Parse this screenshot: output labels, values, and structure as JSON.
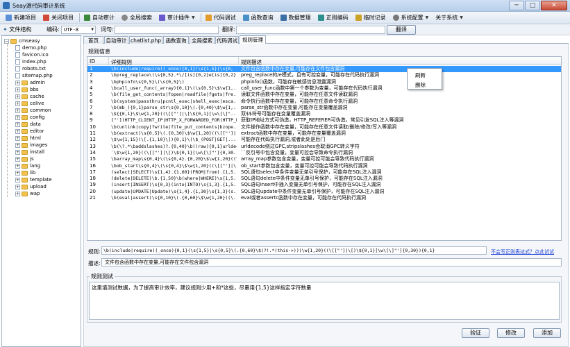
{
  "window": {
    "title": "Seay源代码审计系统"
  },
  "window_controls": {
    "minimize": "─",
    "maximize": "□",
    "close": "✕"
  },
  "menu": {
    "new_project": "新建项目",
    "close_project": "关闭项目",
    "auto_audit": "自动审计",
    "global_search": "全局搜索",
    "audit_plugins": "审计插件",
    "code_debug": "代码调试",
    "function_lookup": "函数查询",
    "data_management": "数据管理",
    "regex_encoding": "正则编码",
    "temp_notes": "临时记录",
    "system_config": "系统配置",
    "about_system": "关于系统"
  },
  "toolbar": {
    "file_structure": "文件结构",
    "encoding_label": "编码:",
    "encoding_value": "UTF-8",
    "word_label": "词句:",
    "translate_label": "翻译:",
    "translate_button": "翻译"
  },
  "tree": {
    "root": "cmseasy",
    "files": [
      "demo.php",
      "favicon.ico",
      "index.php",
      "robots.txt",
      "sitemap.php"
    ],
    "folders": [
      "admin",
      "bbs",
      "cache",
      "celive",
      "common",
      "config",
      "data",
      "editor",
      "html",
      "images",
      "install",
      "js",
      "lang",
      "lib",
      "template",
      "upload",
      "wap"
    ]
  },
  "tabs": [
    "首页",
    "自动审计",
    "chatlist.php",
    "函数查询",
    "全局搜索",
    "代码调试",
    "规则管理"
  ],
  "active_tab_index": 6,
  "rules_group_label": "规则信息",
  "columns": {
    "id": "ID",
    "rule": "详细规则",
    "desc": "规则描述"
  },
  "rules": [
    {
      "id": "1",
      "rule": "\\b(include|require)(_once){0,1}(\\s{1,5}|\\s{0,",
      "desc": "文件包含函数中存在变量,可能存在文件包含漏洞"
    },
    {
      "id": "2",
      "rule": "\\bpreg_replace\\(\\s{0,5}.*\\/[is]{0,2}e[is]{0,2}...",
      "desc": "preg_replace的/e模式，且有可控变量，可能存在代码执行漏洞"
    },
    {
      "id": "3",
      "rule": "\\bphpinfo\\s{0,5}\\(\\s{0,5}\\)",
      "desc": "phpinfo()函数，可能存在敏感信息泄露漏洞"
    },
    {
      "id": "4",
      "rule": "\\bcall_user_func(_array){0,1}\\(\\s{0,5}\\$\\w{1,...",
      "desc": "call_user_func函数中第一个参数为变量，可能存在代码执行漏洞"
    },
    {
      "id": "5",
      "rule": "\\b(file_get_contents|fopen|readfile|fgets|fre...",
      "desc": "读取文件函数中存在变量，可能存在任意文件读取漏洞"
    },
    {
      "id": "6",
      "rule": "\\b(system|passthru|pcntl_exec|shell_exec|esca...",
      "desc": "命令执行函数中存在变量，可能存在任意命令执行漏洞"
    },
    {
      "id": "7",
      "rule": "\\b(mb_){0,1}parse_str\\s{0,10}\\(.{0,40}\\$\\w{1,...",
      "desc": "parse_str函数中存在变量,可能存在变量覆盖漏洞"
    },
    {
      "id": "8",
      "rule": "\\${{0,1}\\$\\w{1,20}((\\[[\"']|\\[\\${0,1}[\\w\\[\\]\"...",
      "desc": "双$$符号可能存在变量覆盖漏洞"
    },
    {
      "id": "9",
      "rule": "[\"'](HTTP_CLIENT_IP|HTTP_X_FORWARDED_FOR|HTTP_R...",
      "desc": "获取IP地址方式可伪造，HTTP_REFERER可伪造，常见引发SQL注入等漏洞"
    },
    {
      "id": "10",
      "rule": "\\b(unlink|copy|fwrite|file_put_contents|bzope...",
      "desc": "文件操作函数中存在变量，可能存在任意文件读取/删除/修改/写入等漏洞"
    },
    {
      "id": "11",
      "rule": "\\b(extract)\\s{0,5}\\(.{0,30}\\$\\w{1,20}((\\[[\"']|...",
      "desc": "extract函数中存在变量，可能存在变量覆盖漏洞"
    },
    {
      "id": "12",
      "rule": "\\$\\w{1,15}(\\[.{1,10}\\]){0,1}\\(\\$_(POST|GET|...",
      "desc": "可能存在代码执行漏洞,或者此处是后门"
    },
    {
      "id": "13",
      "rule": "\\b(\\?.*\\baddslashes)?.{0,40}\\b((raw){0,1}urldec...",
      "desc": "urldecode绕过GPC,stripslashes会取消GPC转义字符"
    },
    {
      "id": "14",
      "rule": "`\\$\\w{1,20}((\\[[\"']|\\[)\\${0,1}[\\w\\[\\]\"']{0,30...",
      "desc": "``反引号中包含变量，变量可控会导致命令执行漏洞"
    },
    {
      "id": "15",
      "rule": "\\barray_map\\s{0,4}\\(\\s{0,4}.{0,20}\\$\\w{1,20}((\\...",
      "desc": "array_map参数包含变量，变量可控可能会导致代码执行漏洞"
    },
    {
      "id": "16",
      "rule": "\\bob_start\\s{0,4}\\(\\s{0,4}\\$\\w{1,20}((\\[[\"']|\\...",
      "desc": "ob_start参数包含变量，变量可控可能会导致代码执行漏洞"
    },
    {
      "id": "17",
      "rule": "(select|SELECT)\\s{1,4}.{1,60}(FROM|from).{1,5...",
      "desc": "SQL语句select中条件变量无单引号保护，可能存在SQL注入漏洞"
    },
    {
      "id": "18",
      "rule": "(delete|DELETE)\\b.{1,50}\\b(where|WHERE)\\s{1,5...",
      "desc": "SQL语句delete中条件变量无单引号保护，可能存在SQL注入漏洞"
    },
    {
      "id": "19",
      "rule": "(insert|INSERT)\\s{0,3}(into|INTO)\\s{1,3}.{1,5...",
      "desc": "SQL语句insert中插入变量无单引号保护，可能存在SQL注入漏洞"
    },
    {
      "id": "20",
      "rule": "(update|UPDATE|Update)\\s{1,4}.{1,30}\\s{1,3}(s...",
      "desc": "SQL语句update中条件变量无单引号保护，可能存在SQL注入漏洞"
    },
    {
      "id": "21",
      "rule": "\\b(eval|assert)\\s{0,10}\\(.{0,60}\\$\\w{1,20}((\\...",
      "desc": "eval或者assertc函数中存在变量，可能存在代码执行漏洞"
    }
  ],
  "selected_row": 0,
  "context_menu": {
    "refresh": "刷新",
    "delete": "删除"
  },
  "rule_field": {
    "label": "规则:",
    "value": "\\b(include|require)(_once){0,1}(\\s{1,5}|\\s{0,5}\\(.{0,60}\\$(?!.*(this->)))\\w{1,20}((\\[[\"']|\\[)\\${0,1}[\\w\\[\\]\"']{0,30}){0,1}"
  },
  "rule_link": "不会写正则表达式？点此试试",
  "desc_field": {
    "label": "描述:",
    "value": "文件包含函数中存在变量,可能存在文件包含漏洞"
  },
  "test_group": {
    "label": "规则测试",
    "text": "这里填测试数据，为了提高审计效率，建议规则少用+和*这些，尽量用{1,5}这样指定字符数量"
  },
  "buttons": {
    "verify": "验证",
    "modify": "修改",
    "add": "添加"
  }
}
